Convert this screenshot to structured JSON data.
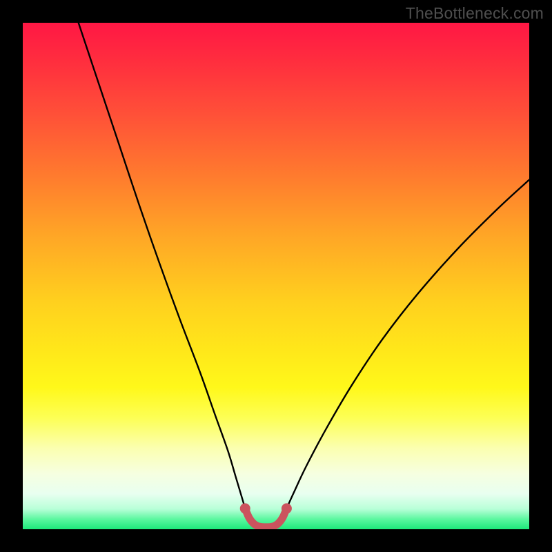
{
  "watermark": "TheBottleneck.com",
  "colors": {
    "frame_bg": "#000000",
    "curve_stroke": "#000000",
    "overlay_stroke": "#cb535e",
    "overlay_fill": "#cb535e"
  },
  "chart_data": {
    "type": "line",
    "title": "",
    "xlabel": "",
    "ylabel": "",
    "xlim": [
      0,
      100
    ],
    "ylim": [
      0,
      100
    ],
    "note": "Curve points are estimated from pixel positions; no numeric axis labels are visible in the image.",
    "series": [
      {
        "name": "bottleneck-curve",
        "points": [
          {
            "x": 11.0,
            "y": 100.0
          },
          {
            "x": 15.0,
            "y": 88.0
          },
          {
            "x": 19.0,
            "y": 76.0
          },
          {
            "x": 23.0,
            "y": 64.0
          },
          {
            "x": 27.0,
            "y": 52.5
          },
          {
            "x": 31.0,
            "y": 41.5
          },
          {
            "x": 35.0,
            "y": 31.0
          },
          {
            "x": 38.0,
            "y": 22.5
          },
          {
            "x": 40.5,
            "y": 15.5
          },
          {
            "x": 42.0,
            "y": 10.5
          },
          {
            "x": 43.2,
            "y": 6.5
          },
          {
            "x": 44.0,
            "y": 3.9
          },
          {
            "x": 44.8,
            "y": 2.1
          },
          {
            "x": 45.6,
            "y": 1.1
          },
          {
            "x": 46.5,
            "y": 0.55
          },
          {
            "x": 48.0,
            "y": 0.4
          },
          {
            "x": 49.5,
            "y": 0.55
          },
          {
            "x": 50.4,
            "y": 1.1
          },
          {
            "x": 51.2,
            "y": 2.1
          },
          {
            "x": 52.0,
            "y": 3.9
          },
          {
            "x": 53.5,
            "y": 7.2
          },
          {
            "x": 56.0,
            "y": 12.5
          },
          {
            "x": 60.0,
            "y": 20.0
          },
          {
            "x": 65.0,
            "y": 28.5
          },
          {
            "x": 71.0,
            "y": 37.5
          },
          {
            "x": 78.0,
            "y": 46.5
          },
          {
            "x": 86.0,
            "y": 55.5
          },
          {
            "x": 94.0,
            "y": 63.5
          },
          {
            "x": 100.0,
            "y": 69.0
          }
        ]
      },
      {
        "name": "near-optimal-overlay",
        "points": [
          {
            "x": 43.9,
            "y": 4.1
          },
          {
            "x": 44.7,
            "y": 2.25
          },
          {
            "x": 45.55,
            "y": 1.15
          },
          {
            "x": 46.5,
            "y": 0.58
          },
          {
            "x": 48.0,
            "y": 0.42
          },
          {
            "x": 49.5,
            "y": 0.58
          },
          {
            "x": 50.45,
            "y": 1.15
          },
          {
            "x": 51.3,
            "y": 2.25
          },
          {
            "x": 52.1,
            "y": 4.1
          }
        ]
      }
    ],
    "overlay_endpoints": [
      {
        "x": 43.9,
        "y": 4.1
      },
      {
        "x": 52.1,
        "y": 4.1
      }
    ]
  }
}
